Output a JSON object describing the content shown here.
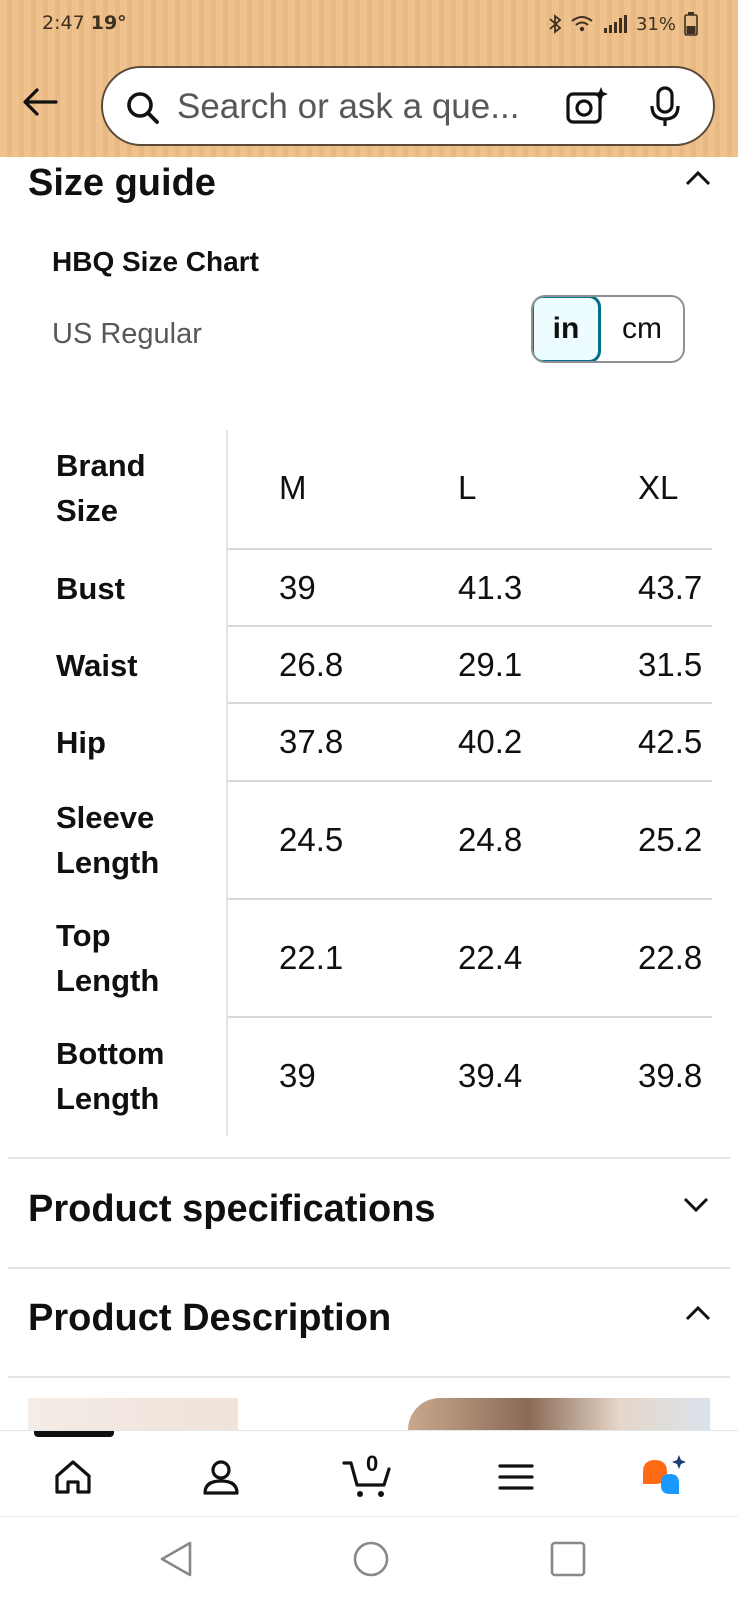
{
  "status_bar": {
    "time": "2:47",
    "temperature": "19°",
    "battery": "31%"
  },
  "search": {
    "placeholder": "Search or ask a que..."
  },
  "size_guide": {
    "title": "Size guide",
    "chart_name": "HBQ Size Chart",
    "fit": "US Regular",
    "units": [
      "in",
      "cm"
    ],
    "selected_unit": "in",
    "table": {
      "header_label": "Brand Size",
      "columns": [
        "M",
        "L",
        "XL"
      ],
      "rows": [
        {
          "label": "Bust",
          "values": [
            "39",
            "41.3",
            "43.7"
          ]
        },
        {
          "label": "Waist",
          "values": [
            "26.8",
            "29.1",
            "31.5"
          ]
        },
        {
          "label": "Hip",
          "values": [
            "37.8",
            "40.2",
            "42.5"
          ]
        },
        {
          "label": "Sleeve Length",
          "values": [
            "24.5",
            "24.8",
            "25.2"
          ]
        },
        {
          "label": "Top Length",
          "values": [
            "22.1",
            "22.4",
            "22.8"
          ]
        },
        {
          "label": "Bottom Length",
          "values": [
            "39",
            "39.4",
            "39.8"
          ]
        }
      ]
    }
  },
  "sections": {
    "specifications": "Product specifications",
    "description": "Product Description"
  },
  "bottom_nav": {
    "cart_count": "0",
    "items": [
      "home-icon",
      "account-icon",
      "cart-icon",
      "menu-icon",
      "rufus-icon"
    ]
  },
  "colors": {
    "header_bg": "#efc28d",
    "toggle_selected_border": "#007185",
    "toggle_selected_bg": "#edfdff",
    "rufus_orange": "#ff6a14",
    "rufus_blue": "#1a98ff"
  }
}
